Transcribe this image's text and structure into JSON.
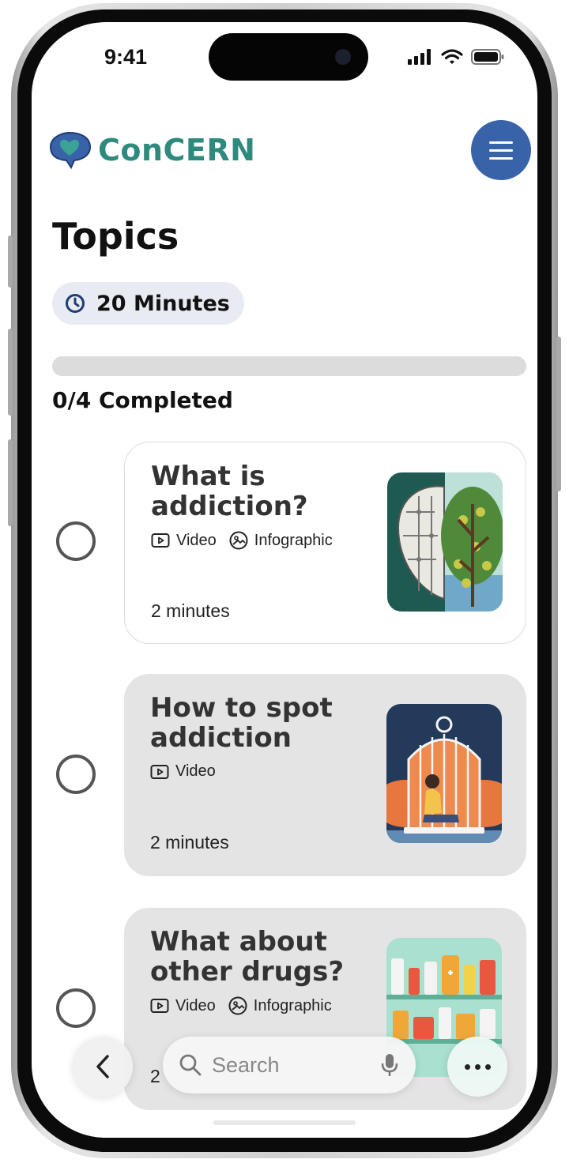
{
  "status_bar": {
    "time": "9:41"
  },
  "app": {
    "logo_text": "ConCERN",
    "logo_icon": "heart-speech-bubble-icon",
    "menu_icon": "hamburger-icon",
    "accent_color": "#3963a8",
    "brand_color": "#2f8a7e"
  },
  "page": {
    "title": "Topics",
    "duration_icon": "clock-icon",
    "duration_label": "20 Minutes",
    "progress_label": "0/4 Completed",
    "progress_fraction": 0
  },
  "topics": [
    {
      "title": "What is addiction?",
      "tags": [
        {
          "icon": "video-icon",
          "label": "Video"
        },
        {
          "icon": "image-icon",
          "label": "Infographic"
        }
      ],
      "duration": "2 minutes",
      "completed": false,
      "thumbnail": "brain-circuit-tree-illustration"
    },
    {
      "title": "How to spot addiction",
      "tags": [
        {
          "icon": "video-icon",
          "label": "Video"
        }
      ],
      "duration": "2 minutes",
      "completed": false,
      "thumbnail": "person-in-birdcage-illustration"
    },
    {
      "title": "What about other drugs?",
      "tags": [
        {
          "icon": "video-icon",
          "label": "Video"
        },
        {
          "icon": "image-icon",
          "label": "Infographic"
        }
      ],
      "duration": "2",
      "completed": false,
      "thumbnail": "pharmacy-shelves-illustration"
    }
  ],
  "bottom_bar": {
    "back_icon": "chevron-left-icon",
    "search_placeholder": "Search",
    "search_icon": "search-icon",
    "mic_icon": "microphone-icon",
    "more_icon": "more-dots-icon"
  }
}
